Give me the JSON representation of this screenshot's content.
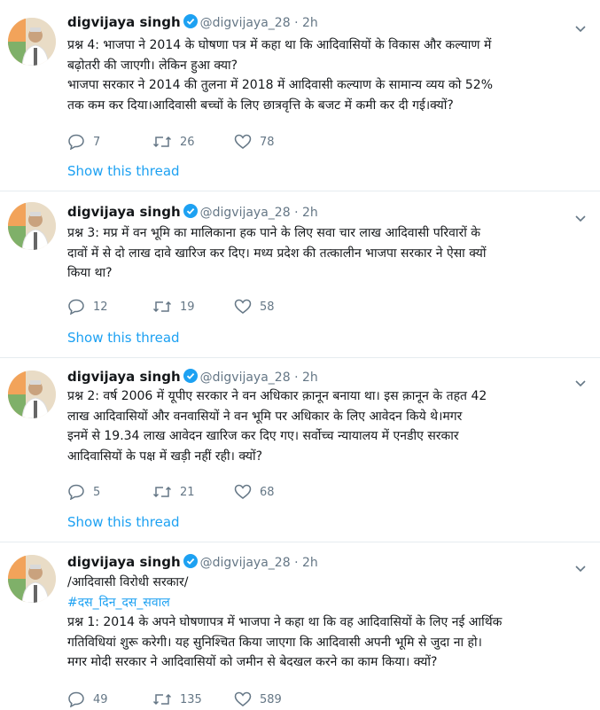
{
  "tweets": [
    {
      "name": "digvijaya singh",
      "handle": "@digvijaya_28",
      "time": "2h",
      "text": "प्रश्न 4: भाजपा ने 2014 के घोषणा पत्र में कहा था कि आदिवासियों के विकास और कल्याण में\nबढ़ोतरी की जाएगी। लेकिन हुआ क्या?\nभाजपा सरकार ने 2014 की तुलना में 2018 में आदिवासी कल्याण के सामान्य व्यय को 52%\nतक कम कर दिया।आदिवासी बच्चों के लिए छात्रवृत्ति के बजट में कमी कर दी गई।क्यों?",
      "replies": "7",
      "retweets": "26",
      "likes": "78",
      "show_thread": "Show this thread"
    },
    {
      "name": "digvijaya singh",
      "handle": "@digvijaya_28",
      "time": "2h",
      "text": "प्रश्न 3: मप्र में वन भूमि का मालिकाना हक पाने के लिए सवा चार लाख आदिवासी परिवारों के\nदावों में से दो लाख दावे खारिज कर दिए। मध्य प्रदेश की तत्कालीन भाजपा सरकार ने ऐसा क्यों\nकिया था?",
      "replies": "12",
      "retweets": "19",
      "likes": "58",
      "show_thread": "Show this thread"
    },
    {
      "name": "digvijaya singh",
      "handle": "@digvijaya_28",
      "time": "2h",
      "text": "प्रश्न 2: वर्ष 2006 में यूपीए सरकार ने वन अधिकार क़ानून बनाया था। इस क़ानून के तहत 42\nलाख आदिवासियों और वनवासियों ने वन भूमि पर अधिकार के लिए आवेदन किये थे।मगर\nइनमें से 19.34 लाख आवेदन खारिज कर दिए गए। सर्वोच्च न्यायालय में एनडीए सरकार\nआदिवासियों के पक्ष में खड़ी नहीं रही। क्यों?",
      "replies": "5",
      "retweets": "21",
      "likes": "68",
      "show_thread": "Show this thread"
    },
    {
      "name": "digvijaya singh",
      "handle": "@digvijaya_28",
      "time": "2h",
      "text_intro": "/आदिवासी विरोधी सरकार/",
      "hashtag": "#दस_दिन_दस_सवाल",
      "text": "प्रश्न 1: 2014 के अपने घोषणापत्र में भाजपा ने कहा था कि वह आदिवासियों के लिए नई आर्थिक\nगतिविधियां शुरू करेगी। यह सुनिश्चित किया जाएगा कि आदिवासी अपनी भूमि से जुदा ना हो।\nमगर मोदी सरकार ने आदिवासियों को जमीन से बेदखल करने का काम किया। क्यों?",
      "replies": "49",
      "retweets": "135",
      "likes": "589"
    }
  ],
  "icons": {
    "reply": "reply-icon",
    "retweet": "retweet-icon",
    "like": "heart-icon",
    "verified": "verified-badge-icon",
    "more": "chevron-down-icon"
  },
  "colors": {
    "link": "#1da1f2",
    "muted": "#657786",
    "text": "#14171a",
    "divider": "#e6ecf0"
  }
}
